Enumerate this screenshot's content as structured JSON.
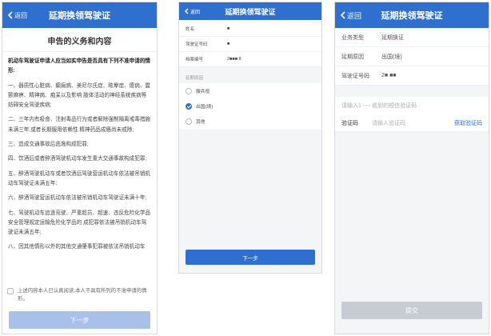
{
  "colors": {
    "primary": "#2f6fcf",
    "disabled_primary": "#a9c1e8",
    "disabled_gray": "#c7cbd2"
  },
  "phone1": {
    "back_label": "返回",
    "title": "延期换领驾驶证",
    "subtitle": "申告的义务和内容",
    "lead": "机动车驾驶证申请人应当如实申告是否具有下列不准申请的情形:",
    "items": [
      "一、器质性心脏病、癫痫病、美尼尔氏症、眩晕症、癔病、震颤麻痹、精神病、痴呆以及影响 肢体活动的神经系统疾病等妨碍安全驾驶疾病;",
      "二、三年内有吸食、注射毒品行为或者解除强制隔离戒毒措施未满三年,或者长期服用依赖性 精神药品成瘾尚未戒除;",
      "三、造成交通事故后逃逸构成犯罪;",
      "四、饮酒后或者醉酒驾驶机动车发生重大交通事故构成犯罪;",
      "五、醉酒驾驶机动车或者饮酒后驾驶营运机动车依法被吊销机动车驾驶证未满五年;",
      "六、醉酒驾驶营运机动车依法被吊销机动车驾驶证未满十年;",
      "七、驾驶机动车追逐竞驶、严重超员、超速、违反危险化学品安全管理规定运输危险化学品的 成犯罪依法被吊销机动车驾驶证未满五年;",
      "八、因其他情形以外的其他交通肇事犯罪被依法吊销机动车"
    ],
    "agree_text": "上述内容本人已认真阅读,本人不具有所列的不准申请的情形。",
    "next_label": "下一步"
  },
  "phone2": {
    "back_label": "返回",
    "title": "延期换领驾驶证",
    "fields": [
      {
        "label": "姓名",
        "value": "■"
      },
      {
        "label": "驾驶证号码",
        "value": "■"
      },
      {
        "label": "档案编号",
        "value": "2■■■ 8"
      }
    ],
    "section_label": "延期原因",
    "options": [
      {
        "label": "服兵役",
        "selected": false
      },
      {
        "label": "出国(境)",
        "selected": true
      },
      {
        "label": "其他",
        "selected": false
      }
    ],
    "next_label": "下一步"
  },
  "phone3": {
    "back_label": "返回",
    "title": "延期换领驾驶证",
    "fields": [
      {
        "label": "业务类型",
        "value": "延期换证"
      },
      {
        "label": "延期原因",
        "value": "出国(境)"
      },
      {
        "label": "驾驶证号码",
        "value": "2■ ■■"
      }
    ],
    "phone_prompt": "请输入1 ---- 收到的短信验证码",
    "code_label": "验证码",
    "code_placeholder": "请输入验证码",
    "send_code_label": "获取验证码",
    "submit_label": "提交"
  }
}
